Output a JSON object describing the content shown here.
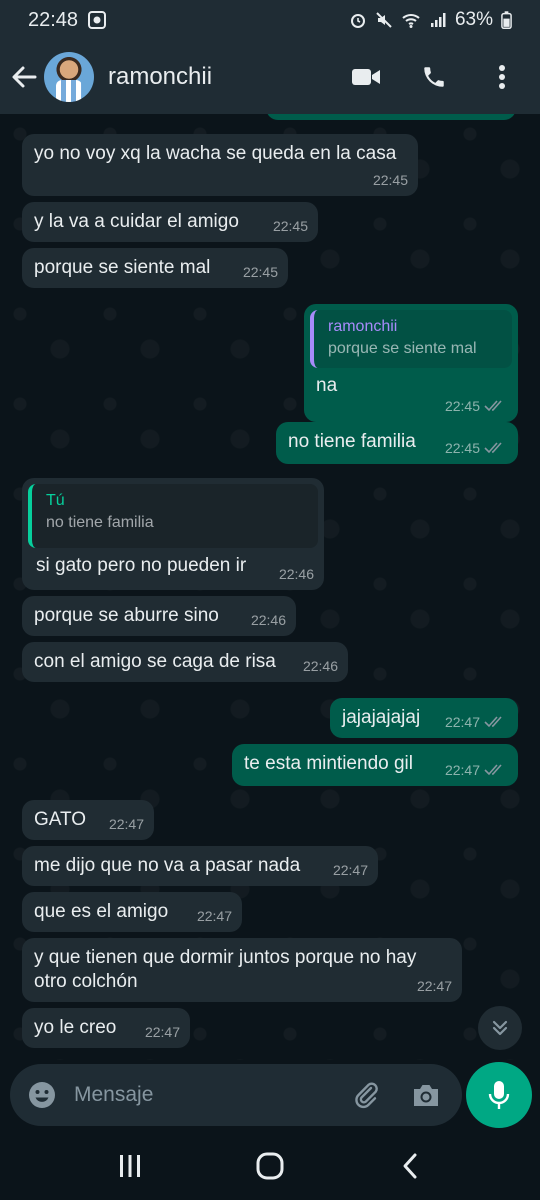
{
  "status_bar": {
    "time": "22:48",
    "battery": "63%"
  },
  "header": {
    "contact_name": "ramonchii"
  },
  "messages": [
    {
      "dir": "in",
      "text": "yo no voy xq la wacha se queda en la casa",
      "time": "22:45"
    },
    {
      "dir": "in",
      "text": "y la va a cuidar el amigo",
      "time": "22:45"
    },
    {
      "dir": "in",
      "text": "porque se siente mal",
      "time": "22:45"
    },
    {
      "dir": "out",
      "quote_name": "ramonchii",
      "quote_text": "porque se siente mal",
      "text": "na",
      "time": "22:45"
    },
    {
      "dir": "out",
      "text": "no tiene familia",
      "time": "22:45"
    },
    {
      "dir": "in",
      "quote_name": "Tú",
      "quote_text": "no tiene familia",
      "text": "si gato pero no pueden ir",
      "time": "22:46"
    },
    {
      "dir": "in",
      "text": "porque se aburre sino",
      "time": "22:46"
    },
    {
      "dir": "in",
      "text": "con el amigo se caga de risa",
      "time": "22:46"
    },
    {
      "dir": "out",
      "text": "jajajajajaj",
      "time": "22:47"
    },
    {
      "dir": "out",
      "text": "te esta mintiendo gil",
      "time": "22:47"
    },
    {
      "dir": "in",
      "text": "GATO",
      "time": "22:47"
    },
    {
      "dir": "in",
      "text": "me dijo que no va a pasar nada",
      "time": "22:47"
    },
    {
      "dir": "in",
      "text": "que es el amigo",
      "time": "22:47"
    },
    {
      "dir": "in",
      "text": "y que tienen que dormir juntos porque no hay",
      "text2": "otro colchón",
      "time": "22:47"
    },
    {
      "dir": "in",
      "text": "yo le creo",
      "time": "22:47"
    }
  ],
  "compose": {
    "placeholder": "Mensaje"
  },
  "colors": {
    "incoming": "#202c33",
    "outgoing": "#005c4b",
    "accent": "#00a884",
    "background": "#0b141a"
  },
  "icons": [
    "back-arrow-icon",
    "video-call-icon",
    "phone-icon",
    "more-options-icon",
    "emoji-icon",
    "attach-icon",
    "camera-icon",
    "mic-icon",
    "scroll-down-icon",
    "recents-icon",
    "home-icon",
    "back-nav-icon"
  ]
}
